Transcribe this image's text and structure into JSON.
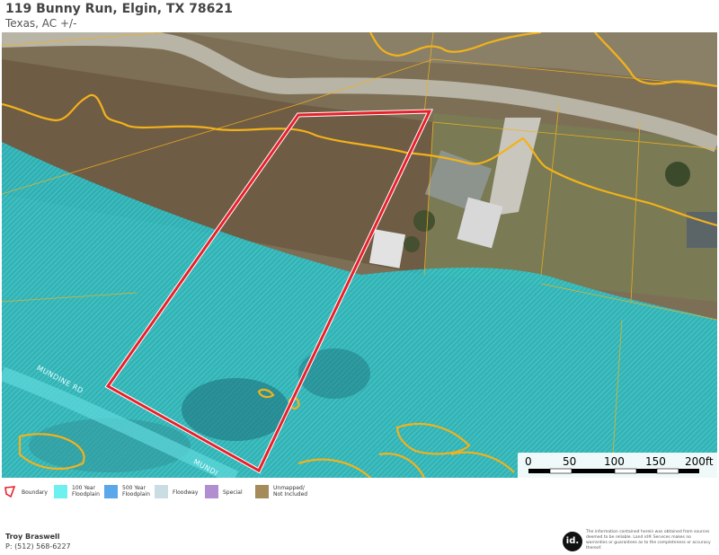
{
  "header": {
    "title": "119 Bunny Run, Elgin, TX 78621",
    "subtitle": "Texas,  AC +/-"
  },
  "map": {
    "road_labels": [
      "MUNDINE RD",
      "MUNDI"
    ],
    "boundary_color": "#e8202a",
    "flood_color": "#1ec8d2",
    "contour_color": "#f3b21b"
  },
  "scale": {
    "labels": [
      "0",
      "50",
      "100",
      "150",
      "200ft"
    ]
  },
  "legend": {
    "items": [
      {
        "label": "Boundary",
        "color": "#e8202a",
        "icon": "boundary-icon"
      },
      {
        "label": "100 Year\nFloodplain",
        "color": "#6ff0f0",
        "icon": "swatch"
      },
      {
        "label": "500 Year\nFloodplain",
        "color": "#5aa7ea",
        "icon": "swatch"
      },
      {
        "label": "Floodway",
        "color": "#c9dde3",
        "icon": "swatch"
      },
      {
        "label": "Special",
        "color": "#b08ed0",
        "icon": "swatch"
      },
      {
        "label": "Unmapped/\nNot Included",
        "color": "#a58a5a",
        "icon": "swatch"
      }
    ]
  },
  "footer": {
    "agent_name": "Troy Braswell",
    "agent_phone": "P: (512) 568-6227",
    "logo_text": "id.",
    "disclaimer": "The information contained herein was obtained from sources deemed to be reliable. Land id® Services makes no warranties or guarantees as to the completeness or accuracy thereof."
  }
}
